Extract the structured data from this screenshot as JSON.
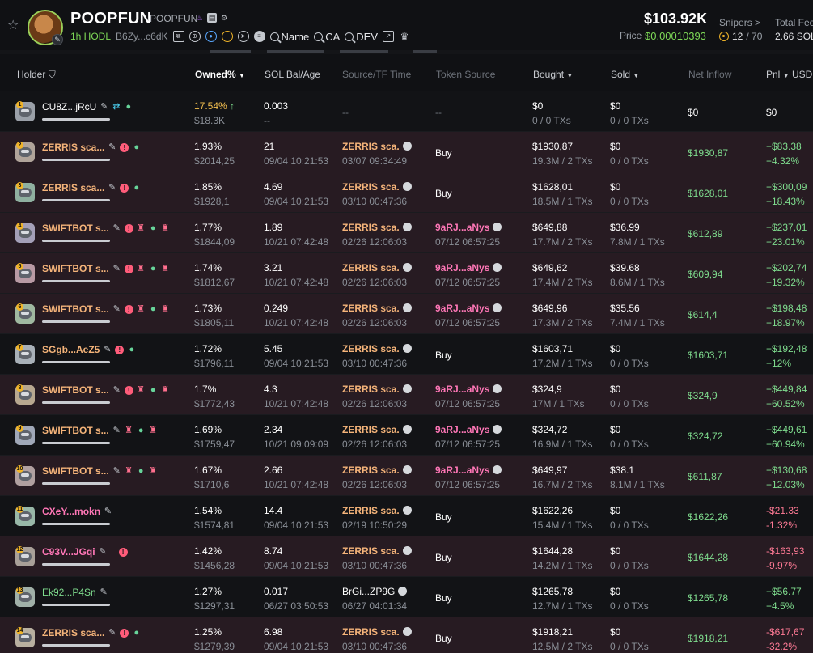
{
  "token": {
    "name": "POOPFUN",
    "symbol": "POOPFUN",
    "hodl": "1h HODL",
    "address": "B6Zy...c6dK",
    "links": {
      "name": "Name",
      "ca": "CA",
      "dev": "DEV"
    }
  },
  "stats": {
    "market_cap": "$103.92K",
    "price_label": "Price",
    "price_value": "$0.00010393",
    "snipers_label": "Snipers >",
    "snipers_count": "12",
    "snipers_total": "/ 70",
    "fees_label": "Total Fees",
    "fees_value": "2.66 SOL"
  },
  "colors": {
    "accent_green": "#7fdc8e",
    "accent_red": "#ff7a95",
    "holder_orange": "#f5b47a",
    "row_tint": "#271b22"
  },
  "columns": {
    "holder": "Holder",
    "owned": "Owned%",
    "sol": "SOL Bal/Age",
    "source": "Source/TF Time",
    "token_source": "Token Source",
    "bought": "Bought",
    "sold": "Sold",
    "net": "Net Inflow",
    "pnl": "Pnl",
    "usd": "USD"
  },
  "rows": [
    {
      "rank": "1",
      "name": "CU8Z...jRcU",
      "name_color": "white",
      "tags": [
        "pen",
        "cyan",
        "grn"
      ],
      "owned": "17.54%",
      "owned_color": "gold",
      "owned_arrow": "↑",
      "owned_usd": "$18.3K",
      "sol": "0.003",
      "age": "--",
      "src": "--",
      "src_time": "",
      "src_color": "dim",
      "tsrc": "--",
      "tsrc_time": "",
      "tsrc_color": "dim",
      "bought": "$0",
      "bought_tx": "0 / 0 TXs",
      "sold": "$0",
      "sold_tx": "0 / 0 TXs",
      "net": "$0",
      "net_color": "white",
      "pnl": "$0",
      "pnl_pct": "",
      "pnl_color": "white",
      "tint": false
    },
    {
      "rank": "2",
      "name": "ZERRIS sca...",
      "name_color": "orange",
      "tags": [
        "pen",
        "red",
        "grn"
      ],
      "owned": "1.93%",
      "owned_color": "white",
      "owned_arrow": "",
      "owned_usd": "$2014,25",
      "sol": "21",
      "age": "09/04 10:21:53",
      "src": "ZERRIS sca.",
      "src_time": "03/07 09:34:49",
      "src_color": "orange",
      "tsrc": "Buy",
      "tsrc_time": "",
      "tsrc_color": "white",
      "bought": "$1930,87",
      "bought_tx": "19.3M / 2 TXs",
      "sold": "$0",
      "sold_tx": "0 / 0 TXs",
      "net": "$1930,87",
      "net_color": "green",
      "pnl": "+$83.38",
      "pnl_pct": "+4.32%",
      "pnl_color": "green",
      "tint": true
    },
    {
      "rank": "3",
      "name": "ZERRIS sca...",
      "name_color": "orange",
      "tags": [
        "pen",
        "red",
        "grn"
      ],
      "owned": "1.85%",
      "owned_color": "white",
      "owned_arrow": "",
      "owned_usd": "$1928,1",
      "sol": "4.69",
      "age": "09/04 10:21:53",
      "src": "ZERRIS sca.",
      "src_time": "03/10 00:47:36",
      "src_color": "orange",
      "tsrc": "Buy",
      "tsrc_time": "",
      "tsrc_color": "white",
      "bought": "$1628,01",
      "bought_tx": "18.5M / 1 TXs",
      "sold": "$0",
      "sold_tx": "0 / 0 TXs",
      "net": "$1628,01",
      "net_color": "green",
      "pnl": "+$300,09",
      "pnl_pct": "+18.43%",
      "pnl_color": "green",
      "tint": true
    },
    {
      "rank": "4",
      "name": "SWIFTBOT s...",
      "name_color": "orange",
      "tags": [
        "pen",
        "red",
        "pink",
        "grn",
        "pink"
      ],
      "owned": "1.77%",
      "owned_color": "white",
      "owned_arrow": "",
      "owned_usd": "$1844,09",
      "sol": "1.89",
      "age": "10/21 07:42:48",
      "src": "ZERRIS sca.",
      "src_time": "02/26 12:06:03",
      "src_color": "orange",
      "tsrc": "9aRJ...aNys",
      "tsrc_time": "07/12 06:57:25",
      "tsrc_color": "pink",
      "bought": "$649,88",
      "bought_tx": "17.7M / 2 TXs",
      "sold": "$36.99",
      "sold_tx": "7.8M / 1 TXs",
      "net": "$612,89",
      "net_color": "green",
      "pnl": "+$237,01",
      "pnl_pct": "+23.01%",
      "pnl_color": "green",
      "tint": true
    },
    {
      "rank": "5",
      "name": "SWIFTBOT s...",
      "name_color": "orange",
      "tags": [
        "pen",
        "red",
        "pink",
        "grn",
        "pink"
      ],
      "owned": "1.74%",
      "owned_color": "white",
      "owned_arrow": "",
      "owned_usd": "$1812,67",
      "sol": "3.21",
      "age": "10/21 07:42:48",
      "src": "ZERRIS sca.",
      "src_time": "02/26 12:06:03",
      "src_color": "orange",
      "tsrc": "9aRJ...aNys",
      "tsrc_time": "07/12 06:57:25",
      "tsrc_color": "pink",
      "bought": "$649,62",
      "bought_tx": "17.4M / 2 TXs",
      "sold": "$39.68",
      "sold_tx": "8.6M / 1 TXs",
      "net": "$609,94",
      "net_color": "green",
      "pnl": "+$202,74",
      "pnl_pct": "+19.32%",
      "pnl_color": "green",
      "tint": true
    },
    {
      "rank": "6",
      "name": "SWIFTBOT s...",
      "name_color": "orange",
      "tags": [
        "pen",
        "red",
        "pink",
        "grn",
        "pink"
      ],
      "owned": "1.73%",
      "owned_color": "white",
      "owned_arrow": "",
      "owned_usd": "$1805,11",
      "sol": "0.249",
      "age": "10/21 07:42:48",
      "src": "ZERRIS sca.",
      "src_time": "02/26 12:06:03",
      "src_color": "orange",
      "tsrc": "9aRJ...aNys",
      "tsrc_time": "07/12 06:57:25",
      "tsrc_color": "pink",
      "bought": "$649,96",
      "bought_tx": "17.3M / 2 TXs",
      "sold": "$35.56",
      "sold_tx": "7.4M / 1 TXs",
      "net": "$614,4",
      "net_color": "green",
      "pnl": "+$198,48",
      "pnl_pct": "+18.97%",
      "pnl_color": "green",
      "tint": true
    },
    {
      "rank": "7",
      "name": "SGgb...AeZ5",
      "name_color": "orange",
      "tags": [
        "pen",
        "red",
        "grn"
      ],
      "owned": "1.72%",
      "owned_color": "white",
      "owned_arrow": "",
      "owned_usd": "$1796,11",
      "sol": "5.45",
      "age": "09/04 10:21:53",
      "src": "ZERRIS sca.",
      "src_time": "03/10 00:47:36",
      "src_color": "orange",
      "tsrc": "Buy",
      "tsrc_time": "",
      "tsrc_color": "white",
      "bought": "$1603,71",
      "bought_tx": "17.2M / 1 TXs",
      "sold": "$0",
      "sold_tx": "0 / 0 TXs",
      "net": "$1603,71",
      "net_color": "green",
      "pnl": "+$192,48",
      "pnl_pct": "+12%",
      "pnl_color": "green",
      "tint": false
    },
    {
      "rank": "8",
      "name": "SWIFTBOT s...",
      "name_color": "orange",
      "tags": [
        "pen",
        "red",
        "pink",
        "grn",
        "pink"
      ],
      "owned": "1.7%",
      "owned_color": "white",
      "owned_arrow": "",
      "owned_usd": "$1772,43",
      "sol": "4.3",
      "age": "10/21 07:42:48",
      "src": "ZERRIS sca.",
      "src_time": "02/26 12:06:03",
      "src_color": "orange",
      "tsrc": "9aRJ...aNys",
      "tsrc_time": "07/12 06:57:25",
      "tsrc_color": "pink",
      "bought": "$324,9",
      "bought_tx": "17M / 1 TXs",
      "sold": "$0",
      "sold_tx": "0 / 0 TXs",
      "net": "$324,9",
      "net_color": "green",
      "pnl": "+$449,84",
      "pnl_pct": "+60.52%",
      "pnl_color": "green",
      "tint": true
    },
    {
      "rank": "9",
      "name": "SWIFTBOT s...",
      "name_color": "orange",
      "tags": [
        "pen",
        "pink",
        "grn",
        "pink"
      ],
      "owned": "1.69%",
      "owned_color": "white",
      "owned_arrow": "",
      "owned_usd": "$1759,47",
      "sol": "2.34",
      "age": "10/21 09:09:09",
      "src": "ZERRIS sca.",
      "src_time": "02/26 12:06:03",
      "src_color": "orange",
      "tsrc": "9aRJ...aNys",
      "tsrc_time": "07/12 06:57:25",
      "tsrc_color": "pink",
      "bought": "$324,72",
      "bought_tx": "16.9M / 1 TXs",
      "sold": "$0",
      "sold_tx": "0 / 0 TXs",
      "net": "$324,72",
      "net_color": "green",
      "pnl": "+$449,61",
      "pnl_pct": "+60.94%",
      "pnl_color": "green",
      "tint": false
    },
    {
      "rank": "10",
      "name": "SWIFTBOT s...",
      "name_color": "orange",
      "tags": [
        "pen",
        "pink",
        "grn",
        "pink"
      ],
      "owned": "1.67%",
      "owned_color": "white",
      "owned_arrow": "",
      "owned_usd": "$1710,6",
      "sol": "2.66",
      "age": "10/21 07:42:48",
      "src": "ZERRIS sca.",
      "src_time": "02/26 12:06:03",
      "src_color": "orange",
      "tsrc": "9aRJ...aNys",
      "tsrc_time": "07/12 06:57:25",
      "tsrc_color": "pink",
      "bought": "$649,97",
      "bought_tx": "16.7M / 2 TXs",
      "sold": "$38.1",
      "sold_tx": "8.1M / 1 TXs",
      "net": "$611,87",
      "net_color": "green",
      "pnl": "+$130,68",
      "pnl_pct": "+12.03%",
      "pnl_color": "green",
      "tint": true
    },
    {
      "rank": "11",
      "name": "CXeY...mokn",
      "name_color": "pink",
      "tags": [
        "pen"
      ],
      "owned": "1.54%",
      "owned_color": "white",
      "owned_arrow": "",
      "owned_usd": "$1574,81",
      "sol": "14.4",
      "age": "09/04 10:21:53",
      "src": "ZERRIS sca.",
      "src_time": "02/19 10:50:29",
      "src_color": "orange",
      "tsrc": "Buy",
      "tsrc_time": "",
      "tsrc_color": "white",
      "bought": "$1622,26",
      "bought_tx": "15.4M / 1 TXs",
      "sold": "$0",
      "sold_tx": "0 / 0 TXs",
      "net": "$1622,26",
      "net_color": "green",
      "pnl": "-$21.33",
      "pnl_pct": "-1.32%",
      "pnl_color": "red",
      "tint": false
    },
    {
      "rank": "12",
      "name": "C93V...JGqi",
      "name_color": "pink",
      "tags": [
        "pen",
        "gap",
        "red"
      ],
      "owned": "1.42%",
      "owned_color": "white",
      "owned_arrow": "",
      "owned_usd": "$1456,28",
      "sol": "8.74",
      "age": "09/04 10:21:53",
      "src": "ZERRIS sca.",
      "src_time": "03/10 00:47:36",
      "src_color": "orange",
      "tsrc": "Buy",
      "tsrc_time": "",
      "tsrc_color": "white",
      "bought": "$1644,28",
      "bought_tx": "14.2M / 1 TXs",
      "sold": "$0",
      "sold_tx": "0 / 0 TXs",
      "net": "$1644,28",
      "net_color": "green",
      "pnl": "-$163,93",
      "pnl_pct": "-9.97%",
      "pnl_color": "red",
      "tint": true
    },
    {
      "rank": "13",
      "name": "Ek92...P4Sn",
      "name_color": "green",
      "tags": [
        "pen"
      ],
      "owned": "1.27%",
      "owned_color": "white",
      "owned_arrow": "",
      "owned_usd": "$1297,31",
      "sol": "0.017",
      "age": "06/27 03:50:53",
      "src": "BrGi...ZP9G",
      "src_time": "06/27 04:01:34",
      "src_color": "white",
      "tsrc": "Buy",
      "tsrc_time": "",
      "tsrc_color": "white",
      "bought": "$1265,78",
      "bought_tx": "12.7M / 1 TXs",
      "sold": "$0",
      "sold_tx": "0 / 0 TXs",
      "net": "$1265,78",
      "net_color": "green",
      "pnl": "+$56.77",
      "pnl_pct": "+4.5%",
      "pnl_color": "green",
      "tint": false
    },
    {
      "rank": "14",
      "name": "ZERRIS sca...",
      "name_color": "orange",
      "tags": [
        "pen",
        "red",
        "grn"
      ],
      "owned": "1.25%",
      "owned_color": "white",
      "owned_arrow": "",
      "owned_usd": "$1279,39",
      "sol": "6.98",
      "age": "09/04 10:21:53",
      "src": "ZERRIS sca.",
      "src_time": "03/10 00:47:36",
      "src_color": "orange",
      "tsrc": "Buy",
      "tsrc_time": "",
      "tsrc_color": "white",
      "bought": "$1918,21",
      "bought_tx": "12.5M / 2 TXs",
      "sold": "$0",
      "sold_tx": "0 / 0 TXs",
      "net": "$1918,21",
      "net_color": "green",
      "pnl": "-$617,67",
      "pnl_pct": "-32.2%",
      "pnl_color": "red",
      "tint": true
    }
  ]
}
